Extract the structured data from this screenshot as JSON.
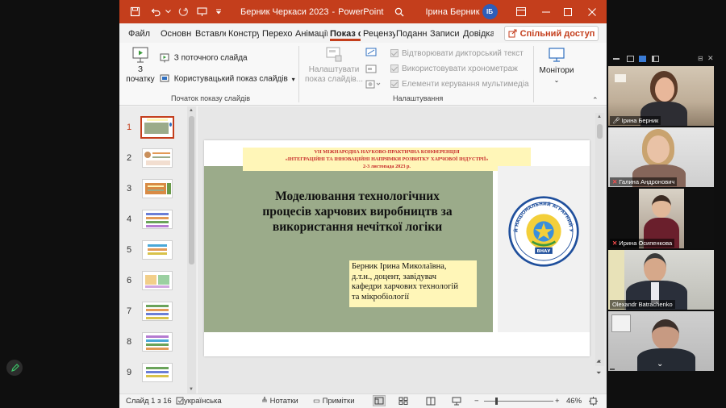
{
  "window": {
    "title": "Берник Черкаси 2023",
    "app": "PowerPoint",
    "user_name": "Ірина Берник",
    "user_initials": "ІБ"
  },
  "tabs": [
    {
      "label": "Файл"
    },
    {
      "label": "Основн"
    },
    {
      "label": "Вставле"
    },
    {
      "label": "Констру"
    },
    {
      "label": "Перехо"
    },
    {
      "label": "Анімації"
    },
    {
      "label": "Показ с"
    },
    {
      "label": "Рецензу"
    },
    {
      "label": "Подання"
    },
    {
      "label": "Записи"
    },
    {
      "label": "Довідка"
    }
  ],
  "share_label": "Спільний доступ",
  "ribbon": {
    "from_start_line1": "З",
    "from_start_line2": "початку",
    "from_current": "З поточного слайда",
    "custom_show": "Користувацький показ слайдів",
    "group_start": "Початок показу слайдів",
    "setup_line1": "Налаштувати",
    "setup_line2": "показ слайдів...",
    "play_narration": "Відтворювати дикторський текст",
    "use_timings": "Використовувати хронометраж",
    "media_controls": "Елементи керування мультимедіа",
    "group_settings": "Налаштування",
    "monitors": "Монітори"
  },
  "thumbnails": [
    "1",
    "2",
    "3",
    "4",
    "5",
    "6",
    "7",
    "8",
    "9"
  ],
  "slide": {
    "conf_line1": "VII МІЖНАРОДНА НАУКОВО-ПРАКТИЧНА КОНФЕРЕНЦІЯ",
    "conf_line2": "«ІНТЕГРАЦІЙНІ ТА ІННОВАЦІЙНІ НАПРЯМКИ РОЗВИТКУ ХАРЧОВОЇ ІНДУСТРІЇ»",
    "conf_line3": "2-3 листопада 2023 р.",
    "title_line1": "Моделювання технологічних",
    "title_line2": "процесів харчових виробництв за",
    "title_line3": "використання нечіткої логіки",
    "author_line1": "Берник Ірина Миколаївна,",
    "author_line2": "д.т.н., доцент, завідувач",
    "author_line3": "кафедри харчових технологій",
    "author_line4": "та мікробіології",
    "logo_text": "ВІННИЦЬКИЙ НАЦІОНАЛЬНИЙ АГРАРНИЙ УНІВЕРСИТЕТ",
    "logo_abbr": "ВНАУ"
  },
  "status": {
    "slide_counter": "Слайд 1 з 16",
    "language": "українська",
    "notes": "Нотатки",
    "comments": "Примітки",
    "zoom": "46%"
  },
  "participants": [
    {
      "name": "Ірина Берник",
      "muted": false
    },
    {
      "name": "Галина Андронович",
      "muted": true
    },
    {
      "name": "Ирина Осипенкова",
      "muted": true
    },
    {
      "name": "Olexandr Batrachenko",
      "muted": false
    },
    {
      "name": "",
      "muted": false
    }
  ],
  "colors": {
    "accent": "#c43e1c",
    "slide_green": "#9bab8a",
    "slide_yellow": "#fff6b8"
  }
}
